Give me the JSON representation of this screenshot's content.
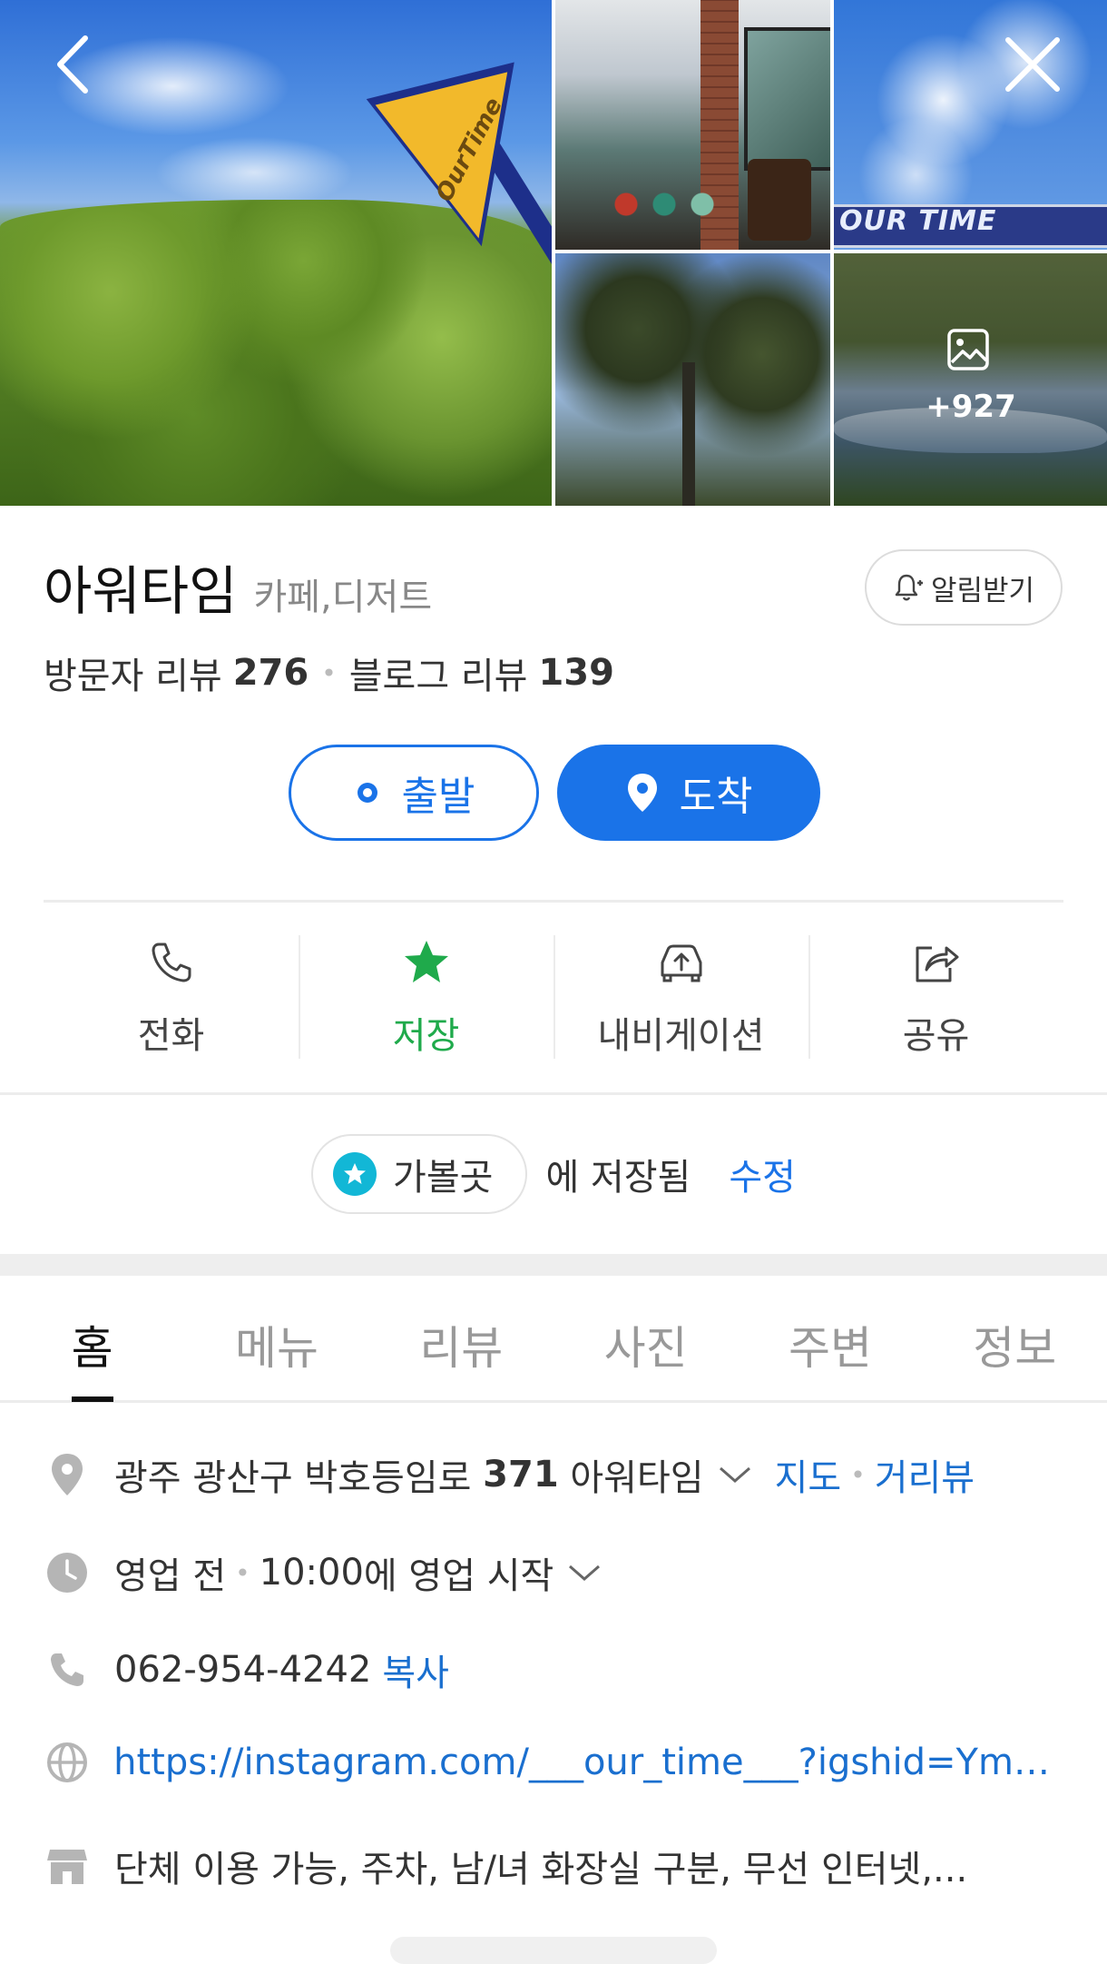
{
  "gallery": {
    "main_sign_text": "OurTime",
    "banner_text": "OUR TIME",
    "more_count": "+927"
  },
  "place": {
    "name": "아워타임",
    "category": "카페,디저트",
    "notify_label": "알림받기",
    "visitor_review_label": "방문자 리뷰",
    "visitor_review_count": "276",
    "blog_review_label": "블로그 리뷰",
    "blog_review_count": "139"
  },
  "route": {
    "start_label": "출발",
    "end_label": "도착"
  },
  "actions": [
    {
      "label": "전화",
      "icon": "phone-icon"
    },
    {
      "label": "저장",
      "icon": "star-icon"
    },
    {
      "label": "내비게이션",
      "icon": "car-navigation-icon"
    },
    {
      "label": "공유",
      "icon": "share-icon"
    }
  ],
  "saved": {
    "list_name": "가볼곳",
    "suffix": "에 저장됨",
    "edit_label": "수정"
  },
  "tabs": [
    "홈",
    "메뉴",
    "리뷰",
    "사진",
    "주변",
    "정보"
  ],
  "details": {
    "address_prefix": "광주 광산구 박호등임로 ",
    "address_number": "371",
    "address_suffix": " 아워타임",
    "map_link": "지도",
    "roadview_link": "거리뷰",
    "status": "영업 전",
    "hours_time": "10:00",
    "hours_suffix": "에 영업 시작",
    "phone": "062-954-4242",
    "copy_label": "복사",
    "website": "https://instagram.com/___our_time___?igshid=YmM...",
    "amenities": "단체 이용 가능, 주차, 남/녀 화장실 구분, 무선 인터넷,..."
  },
  "colors": {
    "accent": "#1a73e8",
    "saved_green": "#1faa4b",
    "list_chip": "#12b7d6"
  }
}
